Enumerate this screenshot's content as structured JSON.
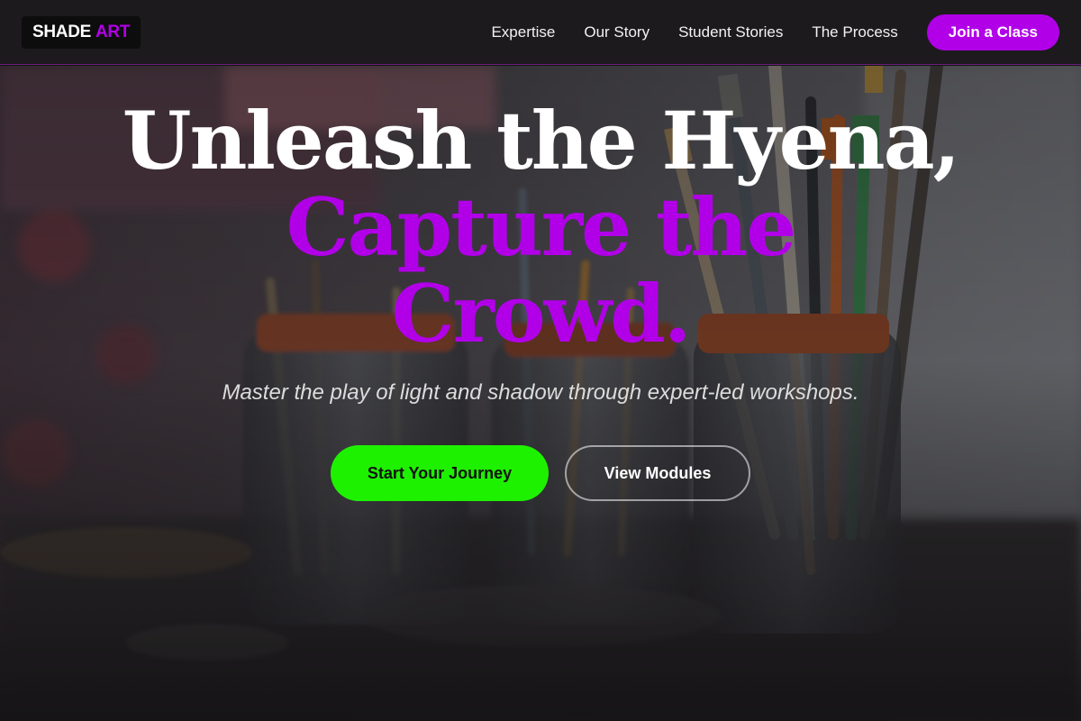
{
  "brand": {
    "part_a": "SHADE",
    "part_b": "ART"
  },
  "nav": {
    "links": [
      "Expertise",
      "Our Story",
      "Student Stories",
      "The Process"
    ],
    "cta": "Join a Class"
  },
  "hero": {
    "headline_line_1": "Unleash the Hyena,",
    "headline_line_2": "Capture the",
    "headline_line_3": "Crowd.",
    "subtitle": "Master the play of light and shadow through expert-led workshops.",
    "primary_button": "Start Your Journey",
    "secondary_button": "View Modules"
  },
  "colors": {
    "accent_purple": "#b100e8",
    "primary_green": "#1ef100",
    "header_bg": "#1c1a1c"
  }
}
